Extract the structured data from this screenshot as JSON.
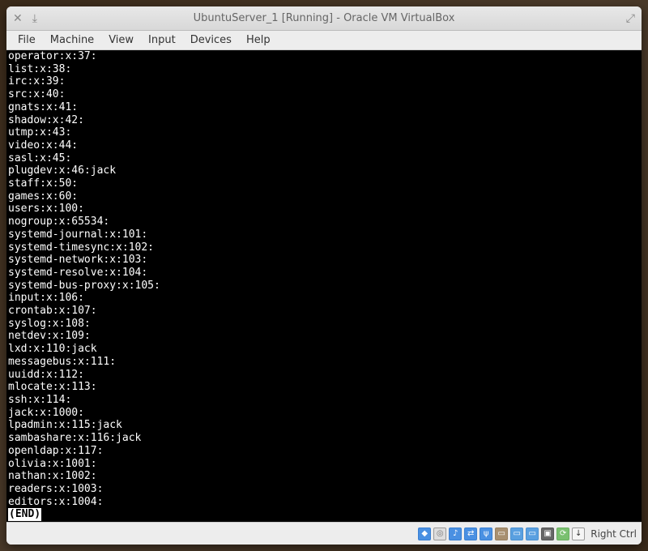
{
  "window": {
    "title": "UbuntuServer_1 [Running] - Oracle VM VirtualBox"
  },
  "menubar": {
    "file": "File",
    "machine": "Machine",
    "view": "View",
    "input": "Input",
    "devices": "Devices",
    "help": "Help"
  },
  "terminal": {
    "lines": [
      "operator:x:37:",
      "list:x:38:",
      "irc:x:39:",
      "src:x:40:",
      "gnats:x:41:",
      "shadow:x:42:",
      "utmp:x:43:",
      "video:x:44:",
      "sasl:x:45:",
      "plugdev:x:46:jack",
      "staff:x:50:",
      "games:x:60:",
      "users:x:100:",
      "nogroup:x:65534:",
      "systemd-journal:x:101:",
      "systemd-timesync:x:102:",
      "systemd-network:x:103:",
      "systemd-resolve:x:104:",
      "systemd-bus-proxy:x:105:",
      "input:x:106:",
      "crontab:x:107:",
      "syslog:x:108:",
      "netdev:x:109:",
      "lxd:x:110:jack",
      "messagebus:x:111:",
      "uuidd:x:112:",
      "mlocate:x:113:",
      "ssh:x:114:",
      "jack:x:1000:",
      "lpadmin:x:115:jack",
      "sambashare:x:116:jack",
      "openldap:x:117:",
      "olivia:x:1001:",
      "nathan:x:1002:",
      "readers:x:1003:",
      "editors:x:1004:"
    ],
    "end_marker": "(END)"
  },
  "statusbar": {
    "host_key": "Right Ctrl"
  }
}
